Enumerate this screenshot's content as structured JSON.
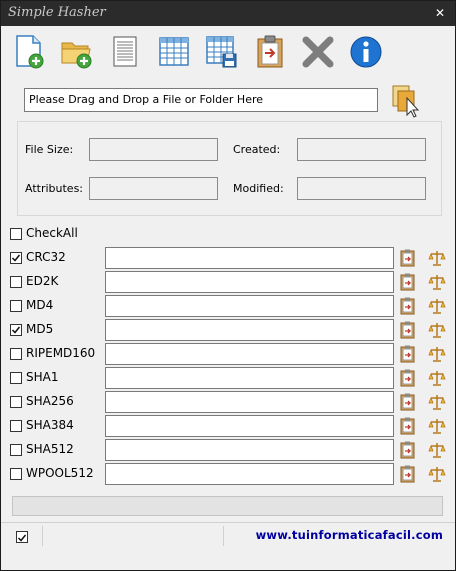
{
  "window": {
    "title": "Simple Hasher",
    "close_label": "✕"
  },
  "toolbar": {
    "buttons": [
      {
        "name": "new-file-button",
        "icon": "new-file-icon"
      },
      {
        "name": "open-folder-button",
        "icon": "open-folder-icon"
      },
      {
        "name": "text-report-button",
        "icon": "document-icon"
      },
      {
        "name": "table-view-button",
        "icon": "table-icon"
      },
      {
        "name": "save-table-button",
        "icon": "save-table-icon"
      },
      {
        "name": "paste-clipboard-button",
        "icon": "clipboard-icon"
      },
      {
        "name": "clear-button",
        "icon": "delete-icon"
      },
      {
        "name": "about-button",
        "icon": "info-icon"
      }
    ]
  },
  "drop": {
    "placeholder": "Please Drag and Drop a File or Folder Here",
    "icon": "drag-drop-icon"
  },
  "info": {
    "file_size_label": "File Size:",
    "created_label": "Created:",
    "attributes_label": "Attributes:",
    "modified_label": "Modified:"
  },
  "checkall": {
    "label": "CheckAll",
    "checked": false
  },
  "hashes": [
    {
      "label": "CRC32",
      "checked": true
    },
    {
      "label": "ED2K",
      "checked": false
    },
    {
      "label": "MD4",
      "checked": false
    },
    {
      "label": "MD5",
      "checked": true
    },
    {
      "label": "RIPEMD160",
      "checked": false
    },
    {
      "label": "SHA1",
      "checked": false
    },
    {
      "label": "SHA256",
      "checked": false
    },
    {
      "label": "SHA384",
      "checked": false
    },
    {
      "label": "SHA512",
      "checked": false
    },
    {
      "label": "WPOOL512",
      "checked": false
    }
  ],
  "progress": {
    "value": 0
  },
  "status": {
    "stay_on_top_checked": true,
    "link": "www.tuinformaticafacil.com"
  },
  "colors": {
    "accent_link": "#0000a0",
    "titlebar": "#2b2b2b"
  }
}
